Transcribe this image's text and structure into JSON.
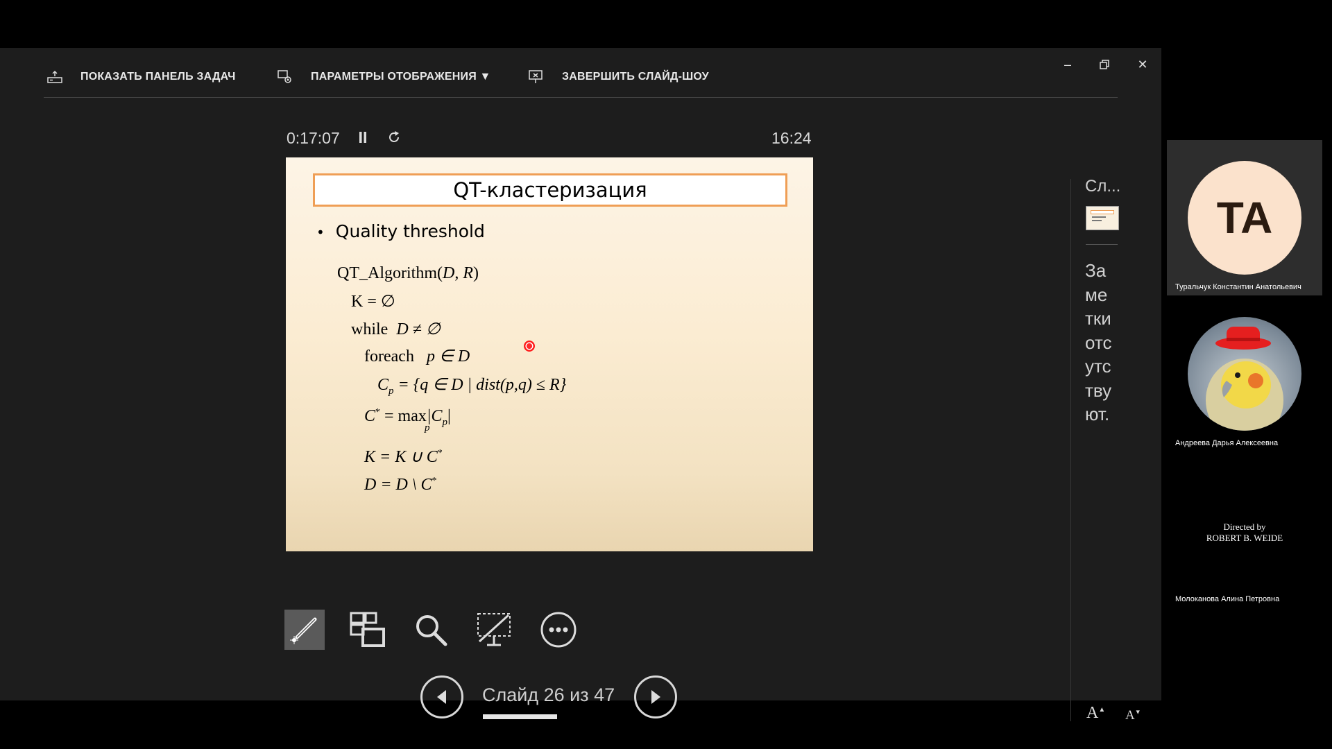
{
  "toolbar": {
    "show_taskbar": "ПОКАЗАТЬ ПАНЕЛЬ ЗАДАЧ",
    "display_settings": "ПАРАМЕТРЫ ОТОБРАЖЕНИЯ ▼",
    "end_show": "ЗАВЕРШИТЬ СЛАЙД-ШОУ"
  },
  "timer": {
    "elapsed": "0:17:07",
    "clock": "16:24"
  },
  "slide": {
    "title": "QT-кластеризация",
    "bullet": "Quality threshold",
    "algo": {
      "l1_a": "QT_Algorithm(",
      "l1_b": "D",
      "l1_c": ", ",
      "l1_d": "R",
      "l1_e": ")",
      "l2": "K = ∅",
      "l3_a": "while",
      "l3_b": "D ≠ ∅",
      "l4_a": "foreach",
      "l4_b": "p ∈ D",
      "l5": "C",
      "l5_sub": "p",
      "l5_rest": "= {q ∈ D |  dist(p,q) ≤ R}",
      "l6": "C",
      "l6_sup": "*",
      "l6_rest": "= max",
      "l6_under": "p",
      "l6_abs": "|C",
      "l6_abs_sub": "p",
      "l6_abs_end": "|",
      "l7": "K = K ∪ C",
      "l7_sup": "*",
      "l8": "D = D \\ C",
      "l8_sup": "*"
    }
  },
  "navigation": {
    "counter": "Слайд 26 из 47",
    "progress": 0.565
  },
  "notes_panel": {
    "label": "Сл...",
    "notes_text": "Заметки отсутствуют."
  },
  "participants": [
    {
      "initials": "TA",
      "name": "Туральчук Константин Анатольевич"
    },
    {
      "name": "Андреева Дарья Алексеевна"
    },
    {
      "credit_line1": "Directed by",
      "credit_line2": "ROBERT B. WEIDE",
      "name": "Молоканова Алина Петровна"
    }
  ],
  "colors": {
    "title_border": "#ef9e55",
    "laser": "#ff2a2a"
  }
}
